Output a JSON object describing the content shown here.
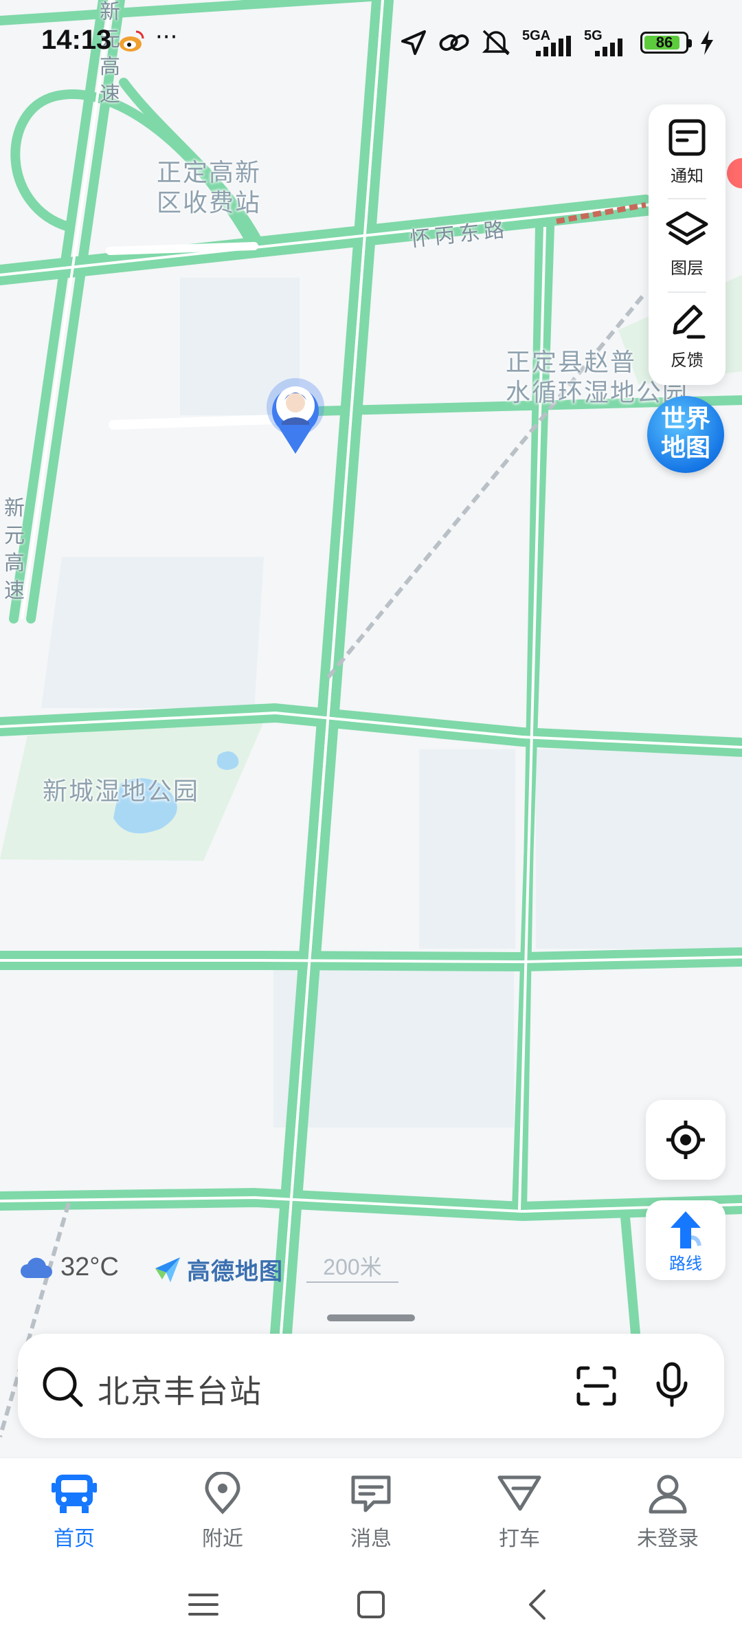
{
  "status_bar": {
    "time": "14:13",
    "network_1": "5GA",
    "network_2": "5G",
    "battery_level": "86"
  },
  "map": {
    "labels": {
      "toll_station": "正定高新\n区收费站",
      "road_east": "怀丙东路",
      "wetland_north": "正定县赵普\n水循环湿地公园",
      "wetland_west": "新城湿地公园",
      "highway_top": "新元高速",
      "highway_left": "新元高速"
    }
  },
  "toolbar": {
    "notice_label": "通知",
    "layers_label": "图层",
    "feedback_label": "反馈"
  },
  "world_map_badge": {
    "line1": "世界",
    "line2": "地图"
  },
  "route_button": {
    "label": "路线"
  },
  "info_row": {
    "temperature": "32°C",
    "brand": "高德地图",
    "scale": "200米"
  },
  "search": {
    "placeholder": "北京丰台站"
  },
  "tabs": [
    {
      "label": "首页",
      "active": true
    },
    {
      "label": "附近",
      "active": false
    },
    {
      "label": "消息",
      "active": false
    },
    {
      "label": "打车",
      "active": false
    },
    {
      "label": "未登录",
      "active": false
    }
  ],
  "colors": {
    "accent": "#1677ff",
    "road": "#7fd8a8",
    "map_bg": "#f4f6f8"
  }
}
